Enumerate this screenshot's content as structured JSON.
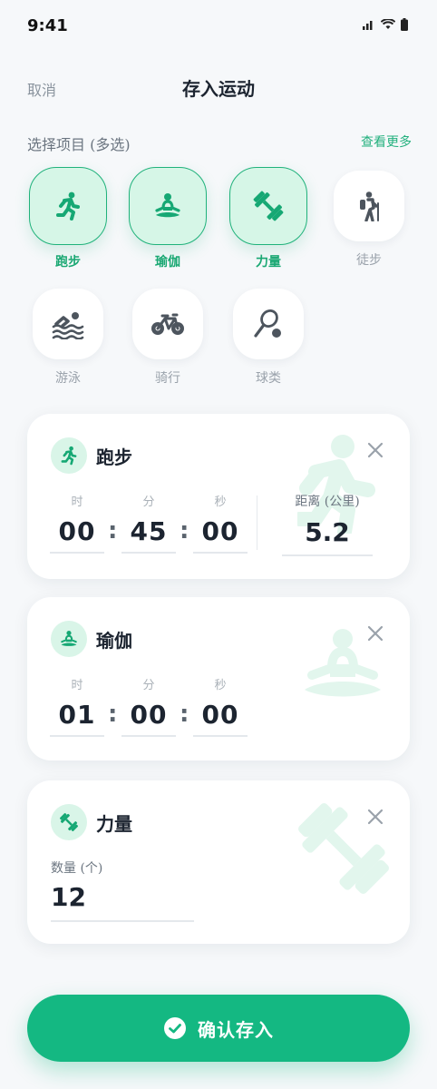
{
  "status": {
    "time": "9:41"
  },
  "header": {
    "cancel": "取消",
    "title": "存入运动"
  },
  "section": {
    "title": "选择项目 (多选)",
    "see_more": "查看更多"
  },
  "activities": [
    {
      "label": "跑步",
      "icon": "running-icon",
      "selected": true
    },
    {
      "label": "瑜伽",
      "icon": "yoga-icon",
      "selected": true
    },
    {
      "label": "力量",
      "icon": "dumbbell-icon",
      "selected": true
    },
    {
      "label": "徒步",
      "icon": "hiking-icon",
      "selected": false
    },
    {
      "label": "游泳",
      "icon": "swimming-icon",
      "selected": false
    },
    {
      "label": "骑行",
      "icon": "cycling-icon",
      "selected": false
    },
    {
      "label": "球类",
      "icon": "racket-icon",
      "selected": false
    }
  ],
  "cards": {
    "running": {
      "name": "跑步",
      "time_labels": {
        "h": "时",
        "m": "分",
        "s": "秒"
      },
      "time": {
        "h": "00",
        "m": "45",
        "s": "00"
      },
      "distance_label": "距离 (公里)",
      "distance": "5.2"
    },
    "yoga": {
      "name": "瑜伽",
      "time_labels": {
        "h": "时",
        "m": "分",
        "s": "秒"
      },
      "time": {
        "h": "01",
        "m": "00",
        "s": "00"
      }
    },
    "strength": {
      "name": "力量",
      "qty_label": "数量 (个)",
      "qty": "12"
    }
  },
  "confirm": {
    "label": "确认存入"
  },
  "colors": {
    "accent": "#14b882",
    "accent_light": "#d6f6e7",
    "text": "#1c2430",
    "muted": "#9aa2ab"
  }
}
